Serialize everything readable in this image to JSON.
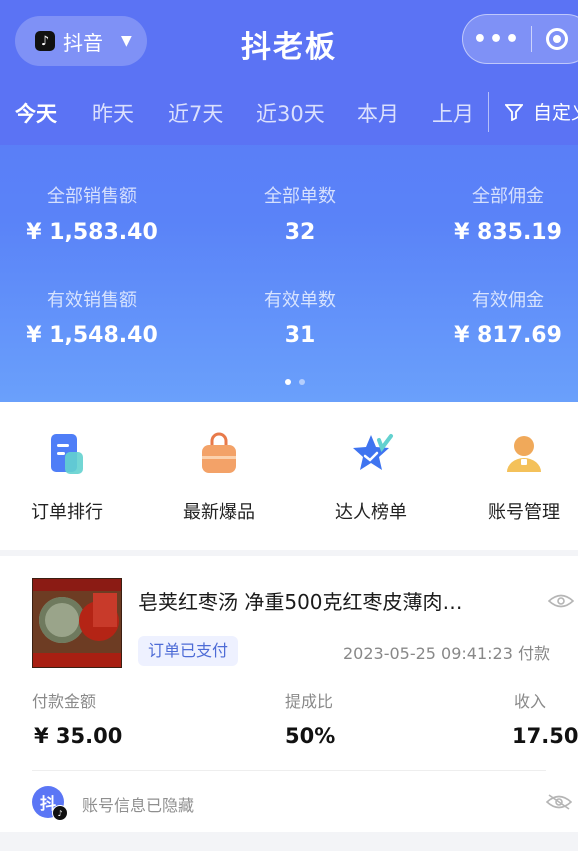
{
  "header": {
    "platform_label": "抖音",
    "brand": "抖老板",
    "capsule_more": "•••"
  },
  "tabs": [
    "今天",
    "昨天",
    "近7天",
    "近30天",
    "本月",
    "上月"
  ],
  "active_tab": "今天",
  "filter_label": "自定义",
  "stats": [
    {
      "label": "全部销售额",
      "value": "¥ 1,583.40"
    },
    {
      "label": "全部单数",
      "value": "32"
    },
    {
      "label": "全部佣金",
      "value": "¥ 835.19"
    },
    {
      "label": "有效销售额",
      "value": "¥ 1,548.40"
    },
    {
      "label": "有效单数",
      "value": "31"
    },
    {
      "label": "有效佣金",
      "value": "¥ 817.69"
    }
  ],
  "carousel": {
    "pages": 2,
    "current": 1
  },
  "menu": [
    {
      "label": "订单排行",
      "icon": "document-icon"
    },
    {
      "label": "最新爆品",
      "icon": "shopping-bag-icon"
    },
    {
      "label": "达人榜单",
      "icon": "star-badge-icon"
    },
    {
      "label": "账号管理",
      "icon": "user-icon"
    }
  ],
  "order": {
    "title": "皂荚红枣汤 净重500克红枣皮薄肉…",
    "status": "订单已支付",
    "pay_time": "2023-05-25 09:41:23 付款",
    "fields": [
      {
        "label": "付款金额",
        "value": "¥ 35.00"
      },
      {
        "label": "提成比",
        "value": "50%"
      },
      {
        "label": "收入",
        "value": "17.50"
      }
    ],
    "account_text": "账号信息已隐藏",
    "avatar_text": "抖"
  },
  "colors": {
    "primary": "#5b76f5",
    "badge_bg": "#eef1ff",
    "badge_text": "#4d6bd6"
  }
}
